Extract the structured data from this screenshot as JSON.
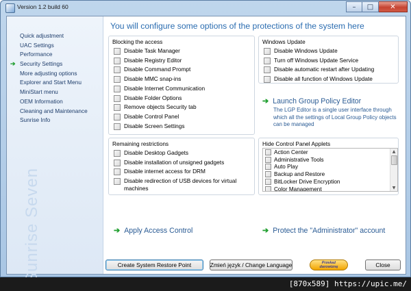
{
  "window": {
    "title": "Version 1.2 build 60",
    "minimize_glyph": "–",
    "maximize_glyph": "□",
    "close_glyph": "✕"
  },
  "sidebar": {
    "items": [
      {
        "label": "Quick adjustment",
        "active": false
      },
      {
        "label": "UAC Settings",
        "active": false
      },
      {
        "label": "Performance",
        "active": false
      },
      {
        "label": "Security Settings",
        "active": true
      },
      {
        "label": "More adjusting options",
        "active": false
      },
      {
        "label": "Explorer and Start Menu",
        "active": false
      },
      {
        "label": "MiniStart menu",
        "active": false
      },
      {
        "label": "OEM Information",
        "active": false
      },
      {
        "label": "Cleaning and Maintenance",
        "active": false
      },
      {
        "label": "Sunrise Info",
        "active": false
      }
    ],
    "brand": "Sunrise Seven",
    "active_arrow": "➔"
  },
  "main": {
    "heading": "You will configure some options of the protections of the system here",
    "blocking_access": {
      "title": "Blocking the access",
      "options": [
        "Disable Task Manager",
        "Disable Registry Editor",
        "Disable Command Prompt",
        "Disable MMC snap-ins",
        "Disable Internet Communication",
        "Disable Folder Options",
        "Remove objects Security tab",
        "Disable Control Panel",
        "Disable Screen Settings"
      ]
    },
    "windows_update": {
      "title": "Windows Update",
      "options": [
        "Disable Windows Update",
        "Turn off Windows Update Service",
        "Disable automatic restart after Updating",
        "Disable all function of Windows Update"
      ]
    },
    "group_policy": {
      "link": "Launch Group Policy Editor",
      "description": "The LGP Editor is a single user interface through which all the settings of Local Group Policy objects can be managed"
    },
    "remaining_restrictions": {
      "title": "Remaining restrictions",
      "options": [
        "Disable Desktop Gadgets",
        "Disable installation of unsigned gadgets",
        "Disable internet access for DRM",
        "Disable redirection of USB devices for virtual machines"
      ]
    },
    "hide_cp_applets": {
      "title": "Hide Control Panel Applets",
      "items": [
        "Action Center",
        "Administrative Tools",
        "Auto Play",
        "Backup and Restore",
        "BitLocker Drive Encryption",
        "Color Management"
      ]
    },
    "apply_access_control": "Apply Access Control",
    "protect_admin": "Protect the \"Administrator\" account"
  },
  "buttons": {
    "restore_point": "Create System Restore Point",
    "language": "Zmień język / Change Language",
    "donate_line1": "Przekaż",
    "donate_line2": "darowiznę",
    "close": "Close"
  },
  "watermark": "[870x589] https://upic.me/",
  "colors": {
    "accent_blue": "#2a6cb0",
    "arrow_green": "#1f9e2e",
    "sidebar_text": "#1e3d6b"
  }
}
